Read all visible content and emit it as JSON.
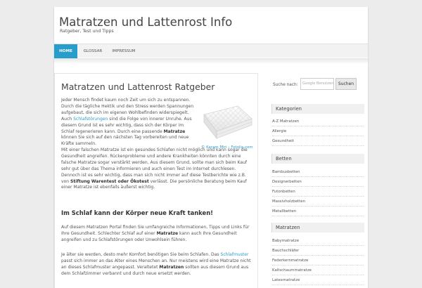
{
  "site": {
    "title": "Matratzen und Lattenrost Info",
    "description": "Ratgeber, Test und Tipps"
  },
  "nav": {
    "items": [
      {
        "label": "Home",
        "active": true
      },
      {
        "label": "Glossar",
        "active": false
      },
      {
        "label": "Impressum",
        "active": false
      }
    ]
  },
  "post": {
    "title": "Matratzen und Lattenrost Ratgeber",
    "image_caption": "© Karam Miri – Fotolia.com",
    "intro": {
      "t1": "Jeder Mensch findet kaum noch Zeit um sich zu entspannen. Durch die tägliche Hektik und den Stress werden Spannungen aufgebaut, die sich im eigenen Wohlbefinden widerspiegelt. Auch ",
      "link1": "Schlafstörungen",
      "t2": " sind die Folge von innerer Unruhe. Aus diesem Grund ist es sehr wichtig, dass sich der Körper im Schlaf regenerieren kann. Durch eine passende ",
      "b1": "Matratze",
      "t3": " können Sie sich auf den nächsten Tag vorbereiten und neue Kräfte sammeln."
    },
    "intro2": {
      "t1": "Mit einer falschen Matratze ist ein gesundes Schlafen nicht möglich und kann sogar die Gesundheit angreifen. Rückenprobleme und andere Krankheiten könnten durch eine falsche Matratze sogar verstärkt werden. Aus diesem Grund, sollte man sich beim Kauf sehr gut über das Thema informieren und auch einen Test im Internet durchlesen. Dennoch ist es sehr wichtig, dass man sich nicht immer auf diese Testberichte wie z.B. von ",
      "b1": "Stiftung Warentest oder Ökotest",
      "t2": " verlässt.  Die persönliche Beratung beim Kauf einer Matratze ist ebenfalls äußerst wichtig."
    },
    "section_heading": "Im Schlaf kann der Körper neue Kraft tanken!",
    "para2": {
      "t1": "Auf diesem Matratzen Portal finden Sie umfangreiche Informationen, Tipps und Links für Ihre Gesundheit. Schlechter Schlaf auf einer ",
      "b1": "Matratze",
      "t2": " kann auch Ihre Gesundheit angreifen und zu Schlafstörungen oder Unwohlsein führen."
    },
    "para3": {
      "t1": "Je älter sie werden, desto mehr Komfort benötigen Sie beim Schlafen. Das ",
      "link1": "Schlafmuster",
      "t2": " passt sich immer an das Alter eines Menschen an. Nur meistens wird eine Matratze nicht an dieses Schlafmuster angepasst. Veraltetet ",
      "b1": "Matratzen",
      "t3": " sollten aus diesem Grund aus dem Schlafzimmer verbannt und durch neue ersetzt werden."
    }
  },
  "sidebar": {
    "search_label": "Suche nach:",
    "search_placeholder": "Google   Benutzerd",
    "search_button": "Suchen",
    "widgets": [
      {
        "title": "Kategorien",
        "links": [
          "A-Z Matratzen",
          "Allergie",
          "Gesundheit"
        ]
      },
      {
        "title": "Betten",
        "links": [
          "Bambusbetten",
          "Designerbetten",
          "Futonbetten",
          "Massivholzbetten",
          "Metallbetten"
        ]
      },
      {
        "title": "Matratzen",
        "links": [
          "Babymatratze",
          "Bauchschläfer",
          "Federkernmatratze",
          "Kaltschaummatratze",
          "Latexmatratze"
        ]
      }
    ]
  },
  "colors": {
    "accent": "#289dcc",
    "background": "#ececec"
  }
}
